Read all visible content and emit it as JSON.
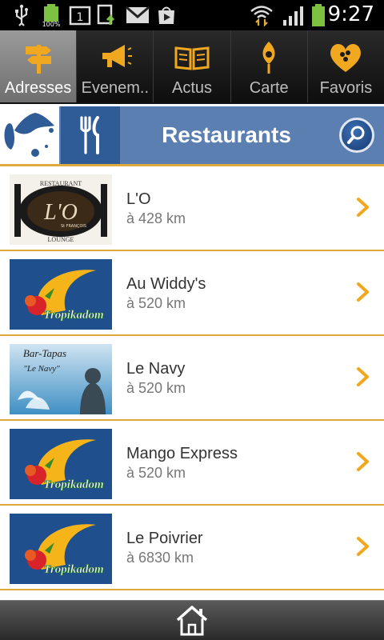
{
  "status_bar": {
    "time": "9:27",
    "battery_percent": "100%",
    "calendar_day": "1",
    "icons": [
      "usb-icon",
      "battery-full-icon",
      "calendar-icon",
      "sync-icon",
      "gmail-icon",
      "play-store-icon",
      "wifi-icon",
      "signal-icon",
      "battery-icon"
    ]
  },
  "tabs": [
    {
      "label": "Adresses",
      "icon": "signpost-icon",
      "active": true
    },
    {
      "label": "Evenem..",
      "icon": "megaphone-icon",
      "active": false
    },
    {
      "label": "Actus",
      "icon": "book-icon",
      "active": false
    },
    {
      "label": "Carte",
      "icon": "map-pin-icon",
      "active": false
    },
    {
      "label": "Favoris",
      "icon": "heart-icon",
      "active": false
    }
  ],
  "category": {
    "title": "Restaurants",
    "icon": "fork-knife-icon"
  },
  "restaurants": [
    {
      "name": "L'O",
      "distance": "à 428 km",
      "logo": "lo-lounge"
    },
    {
      "name": "Au Widdy's",
      "distance": "à 520 km",
      "logo": "tropikadom"
    },
    {
      "name": "Le Navy",
      "distance": "à 520 km",
      "logo": "le-navy"
    },
    {
      "name": "Mango Express",
      "distance": "à 520 km",
      "logo": "tropikadom"
    },
    {
      "name": "Le Poivrier",
      "distance": "à 6830 km",
      "logo": "tropikadom"
    }
  ],
  "logo_text": {
    "lo_top": "RESTAURANT",
    "lo_main": "L'O",
    "lo_sub": "St FRANÇOIS",
    "lo_bottom": "LOUNGE",
    "tropikadom": "Tropikadom",
    "navy_top": "Bar-Tapas",
    "navy_sub": "\"Le Navy\""
  },
  "colors": {
    "accent_orange": "#e0a93c",
    "header_blue": "#5b7fb0",
    "dark_blue": "#2f5b96",
    "tab_active": "#8a8a8a"
  }
}
